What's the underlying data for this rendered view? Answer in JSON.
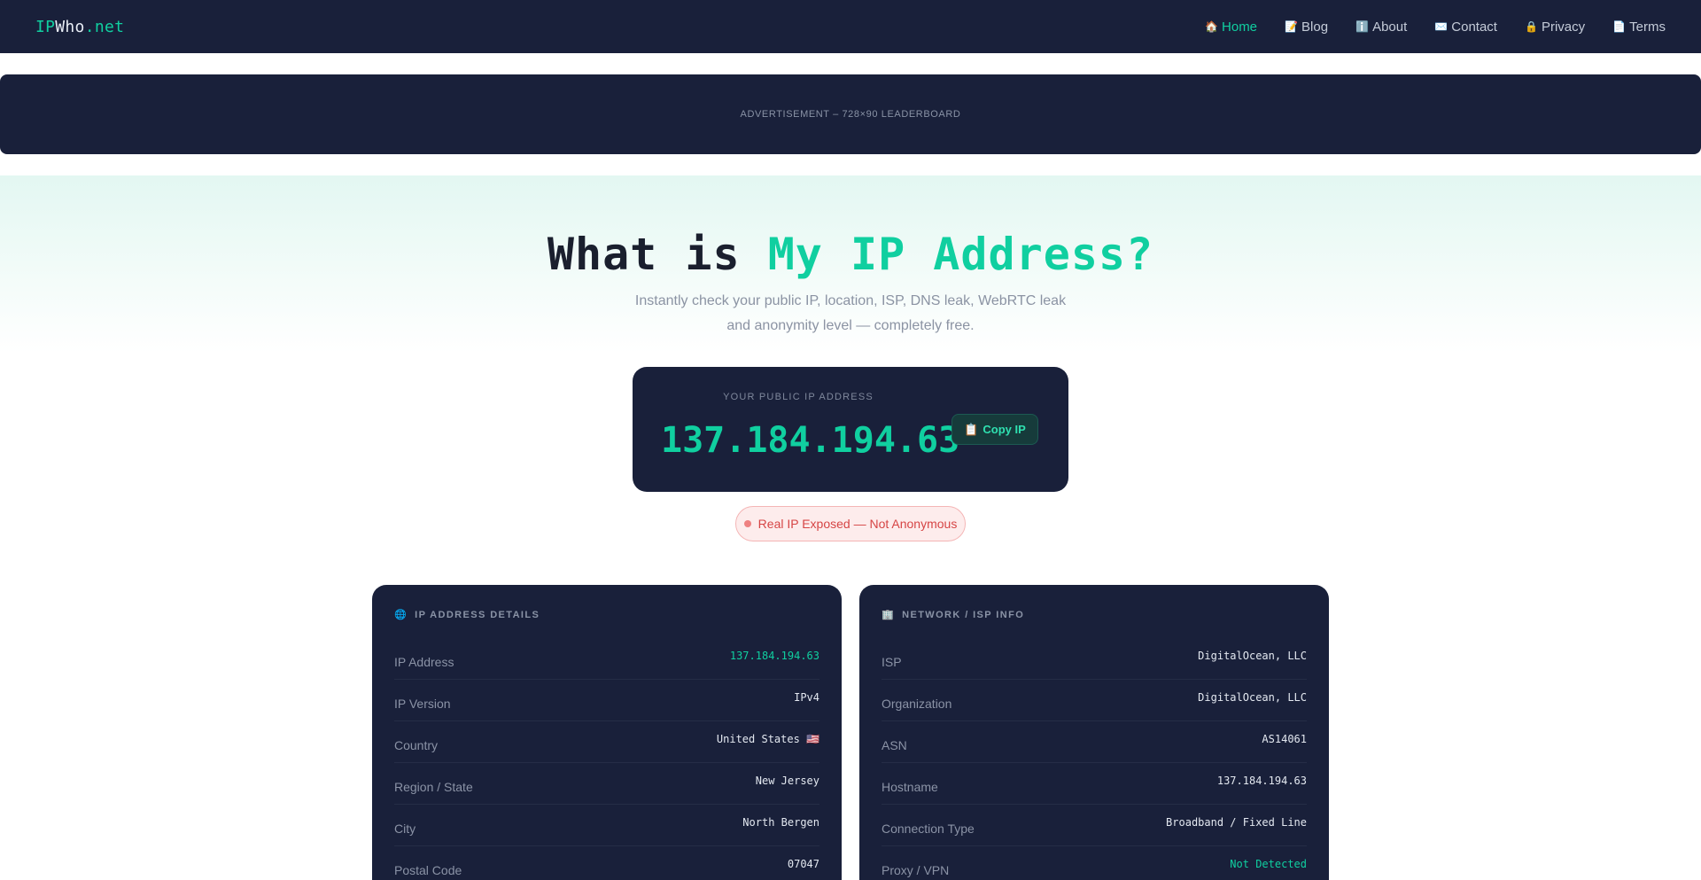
{
  "brand": {
    "part1": "IP",
    "part2": "Who",
    "part3": ".net"
  },
  "nav": [
    {
      "icon": "home-icon",
      "glyph": "🏠",
      "label": "Home",
      "active": true
    },
    {
      "icon": "blog-icon",
      "glyph": "📝",
      "label": "Blog",
      "active": false
    },
    {
      "icon": "info-icon",
      "glyph": "ℹ️",
      "label": "About",
      "active": false
    },
    {
      "icon": "mail-icon",
      "glyph": "✉️",
      "label": "Contact",
      "active": false
    },
    {
      "icon": "lock-icon",
      "glyph": "🔒",
      "label": "Privacy",
      "active": false
    },
    {
      "icon": "document-icon",
      "glyph": "📄",
      "label": "Terms",
      "active": false
    }
  ],
  "ad": {
    "label": "ADVERTISEMENT – 728×90 LEADERBOARD"
  },
  "hero": {
    "title_plain": "What is ",
    "title_accent": "My IP Address?",
    "subtitle": "Instantly check your public IP, location, ISP, DNS leak, WebRTC leak and anonymity level — completely free."
  },
  "ip_card": {
    "label": "YOUR PUBLIC IP ADDRESS",
    "value": "137.184.194.63",
    "copy_label": "Copy IP",
    "copy_glyph": "📋"
  },
  "status": {
    "text": "Real IP Exposed — Not Anonymous"
  },
  "panels": {
    "ip_details": {
      "title": "IP ADDRESS DETAILS",
      "glyph": "🌐",
      "rows": [
        {
          "label": "IP Address",
          "value": "137.184.194.63",
          "highlight": true
        },
        {
          "label": "IP Version",
          "value": "IPv4",
          "highlight": false
        },
        {
          "label": "Country",
          "value": "United States 🇺🇸",
          "highlight": false
        },
        {
          "label": "Region / State",
          "value": "New Jersey",
          "highlight": false
        },
        {
          "label": "City",
          "value": "North Bergen",
          "highlight": false
        },
        {
          "label": "Postal Code",
          "value": "07047",
          "highlight": false
        }
      ]
    },
    "network": {
      "title": "NETWORK / ISP INFO",
      "glyph": "🏢",
      "rows": [
        {
          "label": "ISP",
          "value": "DigitalOcean, LLC",
          "highlight": false
        },
        {
          "label": "Organization",
          "value": "DigitalOcean, LLC",
          "highlight": false
        },
        {
          "label": "ASN",
          "value": "AS14061",
          "highlight": false
        },
        {
          "label": "Hostname",
          "value": "137.184.194.63",
          "highlight": false
        },
        {
          "label": "Connection Type",
          "value": "Broadband / Fixed Line",
          "highlight": false
        },
        {
          "label": "Proxy / VPN",
          "value": "Not Detected",
          "highlight": true
        }
      ]
    }
  },
  "colors": {
    "accent": "#10cfa0",
    "navy": "#19203a",
    "danger": "#d64545"
  }
}
